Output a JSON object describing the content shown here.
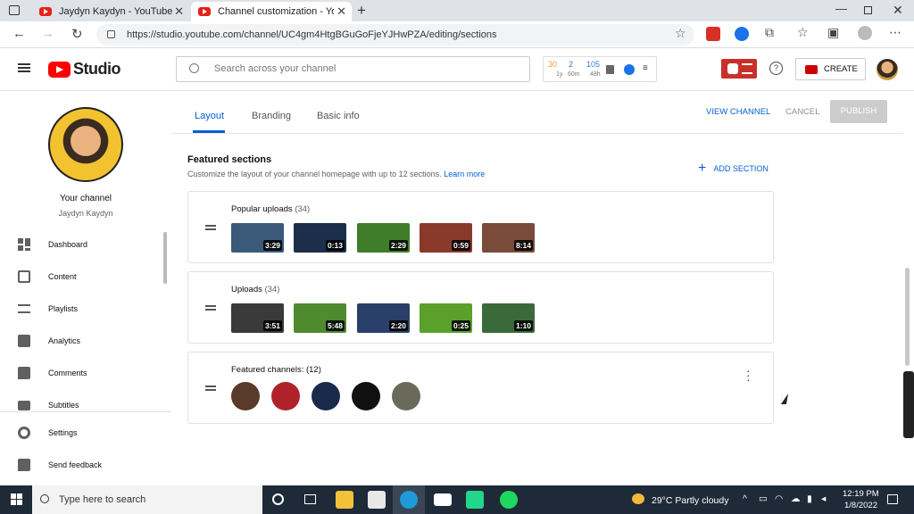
{
  "browser": {
    "tabs": [
      {
        "label": "Jaydyn Kaydyn - YouTube",
        "active": false
      },
      {
        "label": "Channel customization - YouTub",
        "active": true
      }
    ],
    "url": "https://studio.youtube.com/channel/UC4gm4HtgBGuGoFjeYJHwPZA/editing/sections"
  },
  "header": {
    "logo_text": "Studio",
    "search_placeholder": "Search across your channel",
    "stats": {
      "a_value": "30",
      "a_sub": "1y",
      "b_value": "2",
      "b_sub": "60m",
      "c_value": "105",
      "c_sub": "48h"
    },
    "create_label": "CREATE"
  },
  "sidebar": {
    "channel_label": "Your channel",
    "channel_name": "Jaydyn Kaydyn",
    "items": [
      {
        "label": "Dashboard",
        "icon": "dashboard-icon"
      },
      {
        "label": "Content",
        "icon": "content-icon"
      },
      {
        "label": "Playlists",
        "icon": "playlists-icon"
      },
      {
        "label": "Analytics",
        "icon": "analytics-icon"
      },
      {
        "label": "Comments",
        "icon": "comments-icon"
      },
      {
        "label": "Subtitles",
        "icon": "subtitles-icon"
      }
    ],
    "bottom_items": [
      {
        "label": "Settings",
        "icon": "gear-icon"
      },
      {
        "label": "Send feedback",
        "icon": "feedback-icon"
      }
    ]
  },
  "tabs": {
    "layout": "Layout",
    "branding": "Branding",
    "basic_info": "Basic info"
  },
  "actions": {
    "view_channel": "VIEW CHANNEL",
    "cancel": "CANCEL",
    "publish": "PUBLISH"
  },
  "featured": {
    "title": "Featured sections",
    "description": "Customize the layout of your channel homepage with up to 12 sections.",
    "learn_more": "Learn more",
    "add_section": "ADD SECTION",
    "sections": [
      {
        "title": "Popular uploads",
        "count": "(34)",
        "videos": [
          {
            "duration": "3:29",
            "color": "#3b5a7a"
          },
          {
            "duration": "0:13",
            "color": "#1c2e4a"
          },
          {
            "duration": "2:29",
            "color": "#3f7d2a"
          },
          {
            "duration": "0:59",
            "color": "#8a3a2a"
          },
          {
            "duration": "8:14",
            "color": "#7a4a3a"
          }
        ]
      },
      {
        "title": "Uploads",
        "count": "(34)",
        "videos": [
          {
            "duration": "3:51",
            "color": "#3a3a3a"
          },
          {
            "duration": "5:48",
            "color": "#4f8a2f"
          },
          {
            "duration": "2:20",
            "color": "#2a3f6a"
          },
          {
            "duration": "0:25",
            "color": "#5aa02a"
          },
          {
            "duration": "1:10",
            "color": "#3a6a3a"
          }
        ]
      }
    ],
    "channels_section": {
      "title": "Featured channels: (12)",
      "channels": [
        {
          "color": "#5a3a2a"
        },
        {
          "color": "#b0222a"
        },
        {
          "color": "#1a2a4a"
        },
        {
          "color": "#111111"
        },
        {
          "color": "#6a6a5a"
        }
      ]
    }
  },
  "taskbar": {
    "search_placeholder": "Type here to search",
    "weather": "29°C  Partly cloudy",
    "time": "12:19 PM",
    "date": "1/8/2022"
  }
}
